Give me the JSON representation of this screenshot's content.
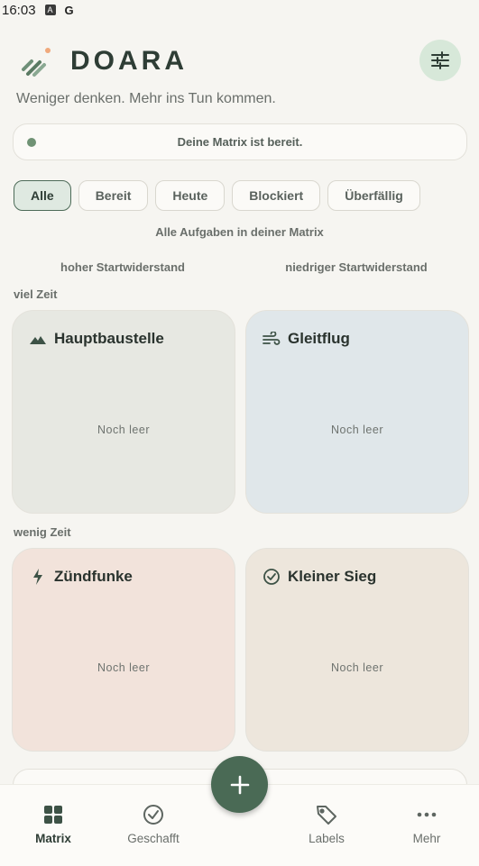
{
  "status_bar": {
    "time": "16:03",
    "icons": [
      "a-box-icon",
      "g-icon"
    ],
    "g_letter": "G",
    "a_letter": "A"
  },
  "header": {
    "brand": "DOARA",
    "tagline": "Weniger denken. Mehr ins Tun kommen."
  },
  "status_card": {
    "text": "Deine Matrix ist bereit."
  },
  "filters": [
    {
      "label": "Alle",
      "active": true
    },
    {
      "label": "Bereit",
      "active": false
    },
    {
      "label": "Heute",
      "active": false
    },
    {
      "label": "Blockiert",
      "active": false
    },
    {
      "label": "Überfällig",
      "active": false
    }
  ],
  "matrix": {
    "title": "Alle Aufgaben in deiner Matrix",
    "col_high": "hoher Startwiderstand",
    "col_low": "niedriger Startwiderstand",
    "row_much": "viel Zeit",
    "row_little": "wenig Zeit",
    "quadrants": [
      {
        "title": "Hauptbaustelle",
        "empty": "Noch leer",
        "icon": "mountain-icon",
        "color": "#e7e8e2"
      },
      {
        "title": "Gleitflug",
        "empty": "Noch leer",
        "icon": "wind-icon",
        "color": "#e0e7ea"
      },
      {
        "title": "Zündfunke",
        "empty": "Noch leer",
        "icon": "bolt-icon",
        "color": "#f2e3db"
      },
      {
        "title": "Kleiner Sieg",
        "empty": "Noch leer",
        "icon": "check-circle-icon",
        "color": "#ede6dc"
      }
    ]
  },
  "nav": [
    {
      "label": "Matrix",
      "icon": "grid-icon",
      "active": true
    },
    {
      "label": "Geschafft",
      "icon": "check-circle-icon",
      "active": false
    },
    {
      "label": "Labels",
      "icon": "tag-icon",
      "active": false
    },
    {
      "label": "Mehr",
      "icon": "more-icon",
      "active": false
    }
  ],
  "fab": {
    "symbol": "+"
  },
  "colors": {
    "accent": "#4a6a55",
    "background": "#f6f5f1"
  }
}
